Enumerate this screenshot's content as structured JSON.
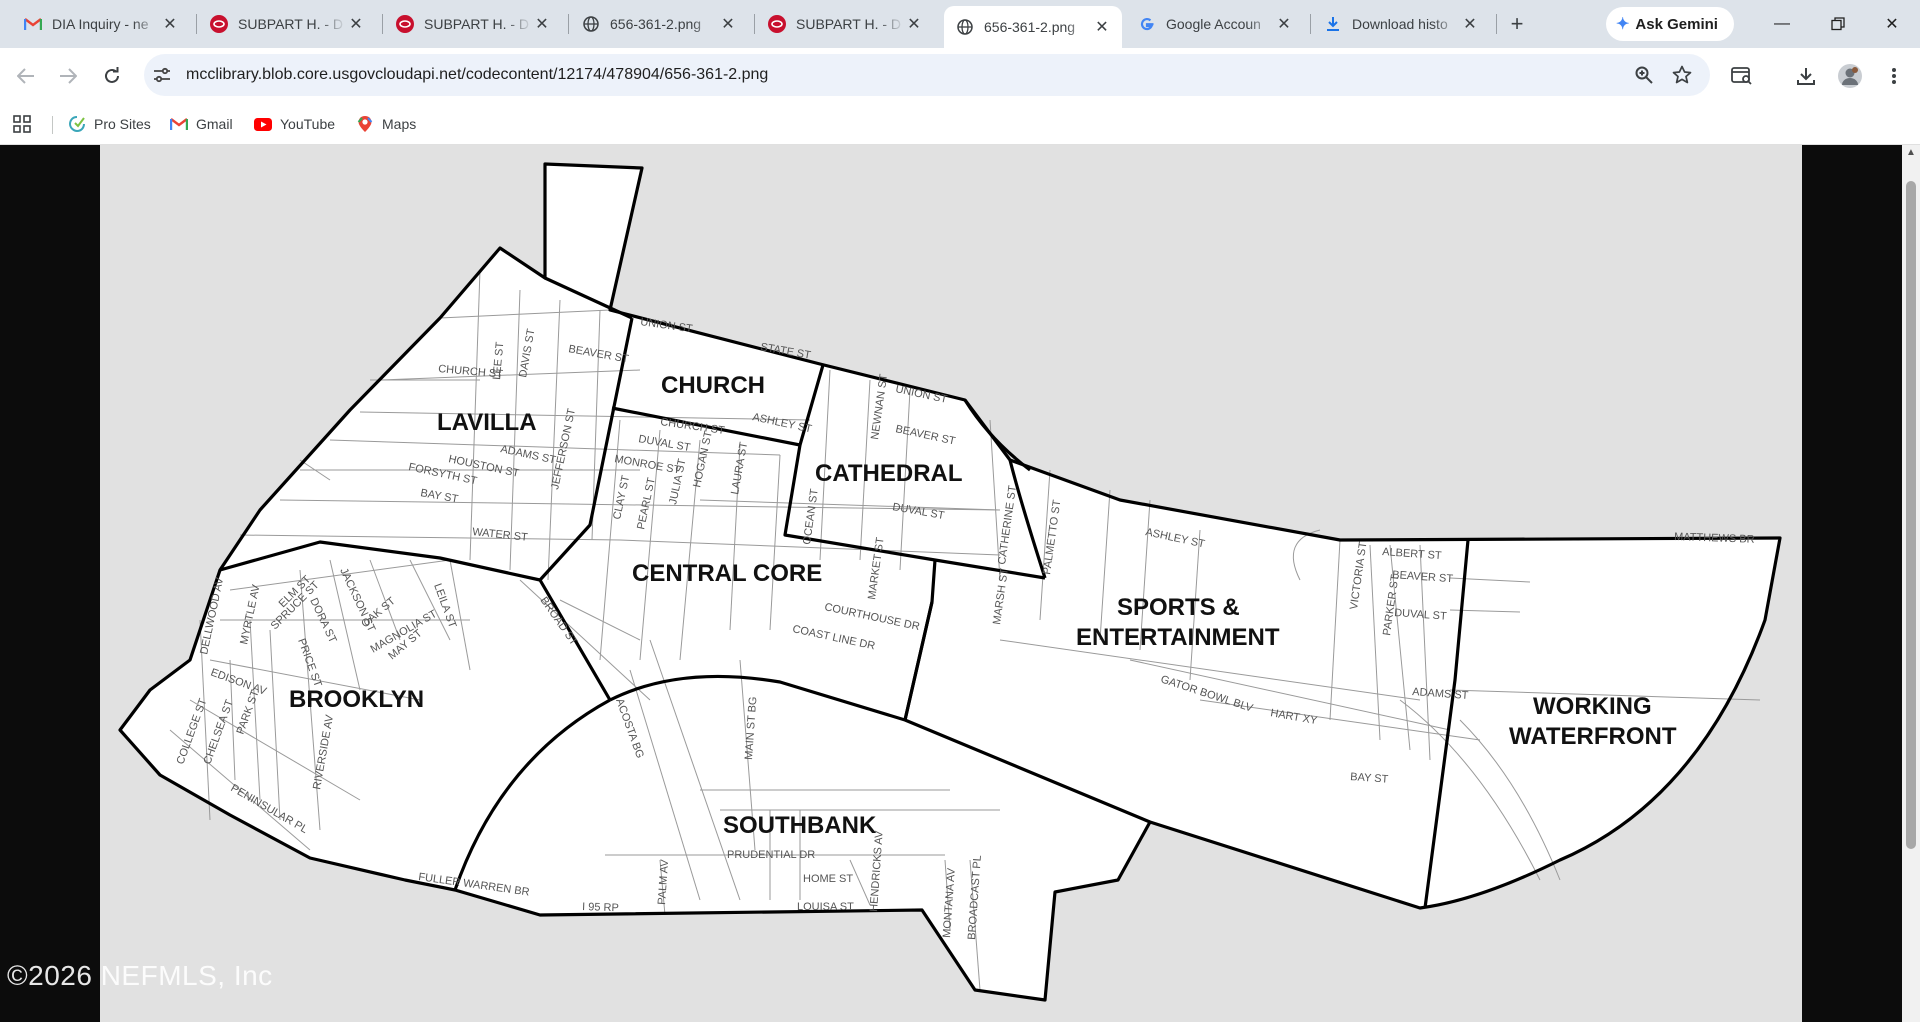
{
  "tabs": [
    {
      "title": "DIA Inquiry - ne",
      "favicon": "gmail-icon",
      "active": false
    },
    {
      "title": "SUBPART H. - D",
      "favicon": "municode-icon",
      "active": false
    },
    {
      "title": "SUBPART H. - D",
      "favicon": "municode-icon",
      "active": false
    },
    {
      "title": "656-361-2.png",
      "favicon": "globe-icon",
      "active": false
    },
    {
      "title": "SUBPART H. - D",
      "favicon": "municode-icon",
      "active": false
    },
    {
      "title": "656-361-2.png",
      "favicon": "globe-icon",
      "active": true
    },
    {
      "title": "Google Accoun",
      "favicon": "google-icon",
      "active": false
    },
    {
      "title": "Download histo",
      "favicon": "download-icon",
      "active": false
    }
  ],
  "gemini_label": "Ask Gemini",
  "address": {
    "url": "mcclibrary.blob.core.usgovcloudapi.net/codecontent/12174/478904/656-361-2.png"
  },
  "bookmarks": [
    {
      "label": "Pro Sites",
      "icon": "pro-sites-icon"
    },
    {
      "label": "Gmail",
      "icon": "gmail-icon"
    },
    {
      "label": "YouTube",
      "icon": "youtube-icon"
    },
    {
      "label": "Maps",
      "icon": "maps-icon"
    }
  ],
  "map": {
    "districts": {
      "lavilla": "LAVILLA",
      "church": "CHURCH",
      "cathedral": "CATHEDRAL",
      "central_core": "CENTRAL CORE",
      "sports_1": "SPORTS &",
      "sports_2": "ENTERTAINMENT",
      "brooklyn": "BROOKLYN",
      "working_1": "WORKING",
      "working_2": "WATERFRONT",
      "southbank": "SOUTHBANK"
    },
    "streets": {
      "state": "STATE ST",
      "union": "UNION ST",
      "church_st": "CHURCH ST",
      "beaver": "BEAVER ST",
      "ashley": "ASHLEY ST",
      "duval": "DUVAL ST",
      "monroe": "MONROE ST",
      "adams": "ADAMS ST",
      "houston": "HOUSTON ST",
      "forsyth": "FORSYTH ST",
      "bay": "BAY ST",
      "water": "WATER ST",
      "jefferson": "JEFFERSON ST",
      "lee": "LEE ST",
      "davis": "DAVIS ST",
      "clay": "CLAY ST",
      "pearl": "PEARL ST",
      "julia": "JULIA ST",
      "hogan": "HOGAN ST",
      "laura": "LAURA ST",
      "newnan": "NEWNAN ST",
      "market": "MARKET ST",
      "ocean": "OCEAN ST",
      "catherine": "CATHERINE ST",
      "marsh": "MARSH ST",
      "palmetto": "PALMETTO ST",
      "courthouse": "COURTHOUSE DR",
      "coastline": "COAST LINE DR",
      "albert": "ALBERT ST",
      "victoria": "VICTORIA ST",
      "parker": "PARKER ST",
      "gator": "GATOR BOWL BLV",
      "hart": "HART XY",
      "matthews": "MATTHEWS BR",
      "main": "MAIN ST BG",
      "acosta": "ACOSTA BG",
      "prudential": "PRUDENTIAL DR",
      "home": "HOME ST",
      "louisa": "LOUISA ST",
      "montana": "MONTANA AV",
      "broadcast": "BROADCAST PL",
      "palm": "PALM AV",
      "hendricks": "HENDRICKS AV",
      "fuller": "FULLER WARREN BR",
      "i95": "I 95 RP",
      "elm": "ELM ST",
      "jackson": "JACKSON ST",
      "oak": "OAK ST",
      "magnolia": "MAGNOLIA ST",
      "leila": "LEILA ST",
      "may": "MAY ST",
      "spruce": "SPRUCE ST",
      "dora": "DORA ST",
      "price": "PRICE ST",
      "edison": "EDISON AV",
      "dellwood": "DELLWOOD AV",
      "myrtle": "MYRTLE AV",
      "park": "PARK ST",
      "chelsea": "CHELSEA ST",
      "college": "COLLEGE ST",
      "riverside": "RIVERSIDE AV",
      "peninsular": "PENINSULAR PL",
      "broad": "BROAD ST"
    }
  },
  "watermark": "©2026 NEFMLS, Inc"
}
